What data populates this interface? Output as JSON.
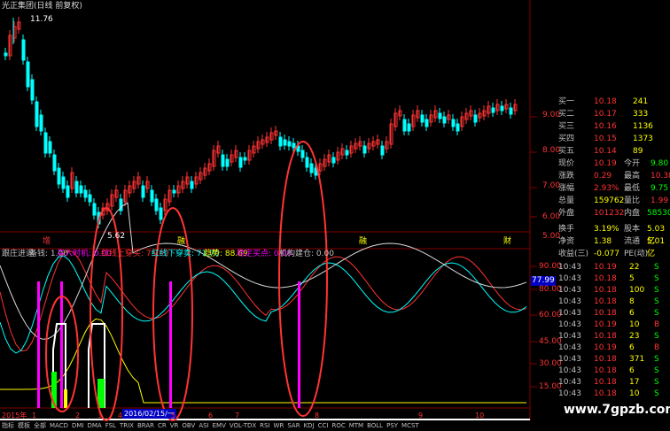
{
  "window_title": "光正集团(日线 前复权)",
  "main_chart": {
    "high_label": "11.76",
    "low_label": "5.62",
    "right_axis": [
      "9.00",
      "8.00",
      "7.00",
      "6.00",
      "5.00"
    ],
    "event_markers": [
      "增",
      "融",
      "融",
      "财"
    ]
  },
  "indicator_panel": {
    "title": "跟庄进退",
    "items": [
      {
        "label": "备钱: 1.00",
        "color": "#c0c0c0"
      },
      {
        "label": "买入时机: 0.00",
        "color": "#ff00ff"
      },
      {
        "label": "红线上穿买: 75.00",
        "color": "#ff3333"
      },
      {
        "label": "红线下穿卖: 71.70",
        "color": "#00ffff"
      },
      {
        "label": "趋势: 88.69",
        "color": "#ffff00"
      },
      {
        "label": "稳定买点: 0.00",
        "color": "#ff00ff"
      },
      {
        "label": "机构建仓: 0.00",
        "color": "#c0c0c0"
      }
    ],
    "right_axis": [
      "90.00",
      "80.00",
      "60.00",
      "45.00",
      "30.00",
      "15.00"
    ],
    "current_value": "77.99"
  },
  "order_book": [
    {
      "label": "买一",
      "price": "10.18",
      "volume": "241"
    },
    {
      "label": "买二",
      "price": "10.17",
      "volume": "333"
    },
    {
      "label": "买三",
      "price": "10.16",
      "volume": "1136"
    },
    {
      "label": "买四",
      "price": "10.15",
      "volume": "1373"
    },
    {
      "label": "买五",
      "price": "10.14",
      "volume": "89"
    }
  ],
  "quote_stats": [
    {
      "l1": "现价",
      "v1": "10.19",
      "l2": "今开",
      "v2": "9.80",
      "c1": "#ff3333",
      "c2": "#00ff00"
    },
    {
      "l1": "涨跌",
      "v1": "0.29",
      "l2": "最高",
      "v2": "10.38",
      "c1": "#ff3333",
      "c2": "#ff3333"
    },
    {
      "l1": "涨幅",
      "v1": "2.93%",
      "l2": "最低",
      "v2": "9.75",
      "c1": "#ff3333",
      "c2": "#00ff00"
    },
    {
      "l1": "总量",
      "v1": "159762",
      "l2": "量比",
      "v2": "1.99",
      "c1": "#ffff00",
      "c2": "#ff3333"
    },
    {
      "l1": "外盘",
      "v1": "101232",
      "l2": "内盘",
      "v2": "58530",
      "c1": "#ff3333",
      "c2": "#00ff00"
    },
    {
      "l1": "换手",
      "v1": "3.19%",
      "l2": "股本",
      "v2": "5.03亿",
      "c1": "#ffff00",
      "c2": "#ffff00"
    },
    {
      "l1": "净资",
      "v1": "1.38",
      "l2": "流通",
      "v2": "5.01亿",
      "c1": "#ffff00",
      "c2": "#ffff00"
    },
    {
      "l1": "收益(三)",
      "v1": "-0.077",
      "l2": "PE(动)",
      "v2": "",
      "c1": "#ffff00",
      "c2": "#ffff00"
    }
  ],
  "ticks": [
    {
      "time": "10:43",
      "price": "10.19",
      "vol": "22",
      "side": "S"
    },
    {
      "time": "10:43",
      "price": "10.18",
      "vol": "5",
      "side": "S"
    },
    {
      "time": "10:43",
      "price": "10.18",
      "vol": "100",
      "side": "S"
    },
    {
      "time": "10:43",
      "price": "10.18",
      "vol": "8",
      "side": "S"
    },
    {
      "time": "10:43",
      "price": "10.18",
      "vol": "6",
      "side": "S"
    },
    {
      "time": "10:43",
      "price": "10.19",
      "vol": "10",
      "side": "B"
    },
    {
      "time": "10:43",
      "price": "10.18",
      "vol": "23",
      "side": "S"
    },
    {
      "time": "10:43",
      "price": "10.19",
      "vol": "6",
      "side": "B"
    },
    {
      "time": "10:43",
      "price": "10.18",
      "vol": "371",
      "side": "S"
    },
    {
      "time": "10:43",
      "price": "10.18",
      "vol": "6",
      "side": "S"
    },
    {
      "time": "10:43",
      "price": "10.18",
      "vol": "17",
      "side": "S"
    },
    {
      "time": "10:43",
      "price": "10.18",
      "vol": "10",
      "side": "S"
    }
  ],
  "time_axis": {
    "year_label": "2015年",
    "ticks": [
      "1",
      "2",
      "3",
      "4",
      "5",
      "6",
      "7",
      "8",
      "9",
      "10"
    ],
    "selected_date": "2016/02/15/一"
  },
  "bottom_tabs": [
    "指标",
    "模板",
    "全部",
    "MACD",
    "DMI",
    "DMA",
    "FSL",
    "TRIX",
    "BRAR",
    "CR",
    "VR",
    "OBV",
    "ASI",
    "EMV",
    "VOL-TDX",
    "RSI",
    "WR",
    "SAR",
    "KDJ",
    "CCI",
    "ROC",
    "MTM",
    "BOLL",
    "PSY",
    "MCST"
  ],
  "watermark": "www.7gpzb.com",
  "colors": {
    "up": "#ff3333",
    "down": "#00ffff",
    "grid": "#800000"
  }
}
